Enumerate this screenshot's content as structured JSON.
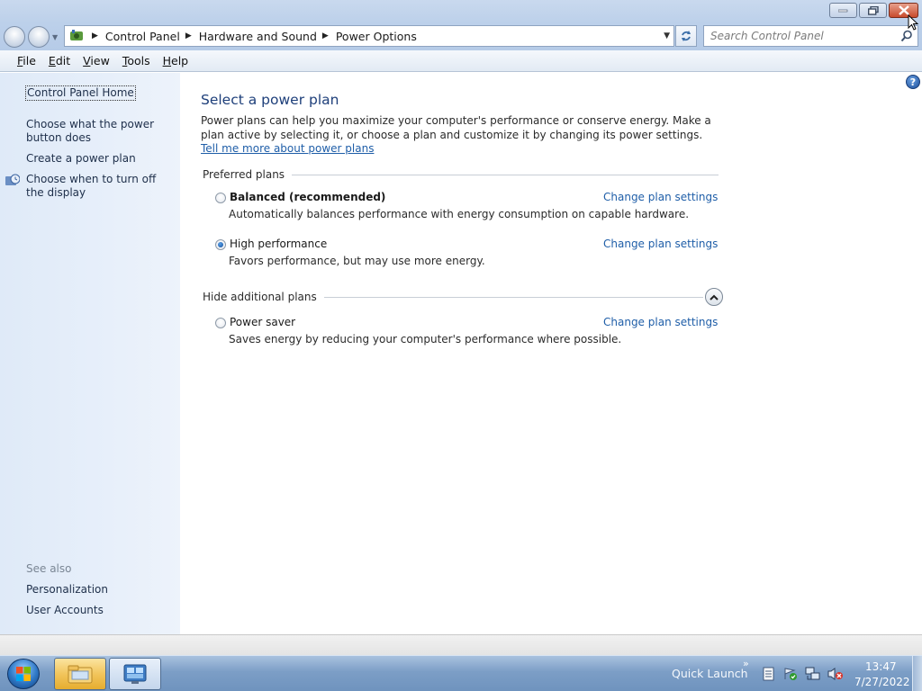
{
  "window": {
    "caption_buttons": [
      "minimize-icon",
      "restore-icon",
      "close-icon"
    ]
  },
  "address_bar": {
    "breadcrumbs": [
      "Control Panel",
      "Hardware and Sound",
      "Power Options"
    ],
    "search_placeholder": "Search Control Panel"
  },
  "menu": {
    "items": [
      {
        "accel": "F",
        "rest": "ile"
      },
      {
        "accel": "E",
        "rest": "dit"
      },
      {
        "accel": "V",
        "rest": "iew"
      },
      {
        "accel": "T",
        "rest": "ools"
      },
      {
        "accel": "H",
        "rest": "elp"
      }
    ]
  },
  "sidebar": {
    "home": "Control Panel Home",
    "links": [
      "Choose what the power button does",
      "Create a power plan",
      "Choose when to turn off the display"
    ],
    "see_also_title": "See also",
    "see_also": [
      "Personalization",
      "User Accounts"
    ]
  },
  "main": {
    "title": "Select a power plan",
    "intro_text": "Power plans can help you maximize your computer's performance or conserve energy. Make a plan active by selecting it, or choose a plan and customize it by changing its power settings. ",
    "intro_link": "Tell me more about power plans",
    "preferred_header": "Preferred plans",
    "additional_header": "Hide additional plans",
    "plans": [
      {
        "name": "Balanced (recommended)",
        "description": "Automatically balances performance with energy consumption on capable hardware.",
        "selected": false,
        "link": "Change plan settings"
      },
      {
        "name": "High performance",
        "description": "Favors performance, but may use more energy.",
        "selected": true,
        "link": "Change plan settings"
      },
      {
        "name": "Power saver",
        "description": "Saves energy by reducing your computer's performance where possible.",
        "selected": false,
        "link": "Change plan settings"
      }
    ]
  },
  "taskbar": {
    "quick_launch": "Quick Launch",
    "time": "13:47",
    "date": "7/27/2022"
  }
}
